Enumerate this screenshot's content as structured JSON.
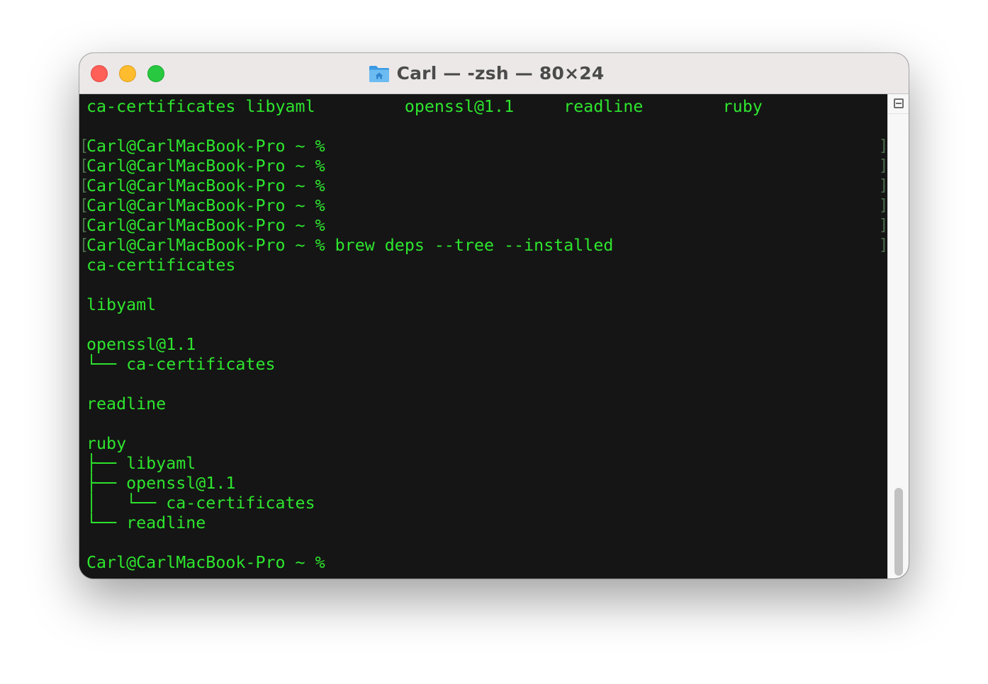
{
  "window": {
    "title": "Carl — -zsh — 80×24",
    "folder_icon": "home-folder-icon"
  },
  "colors": {
    "terminal_bg": "#151515",
    "terminal_text": "#2ee52e",
    "titlebar_bg": "#ece8e8",
    "close": "#fe5f57",
    "minimize": "#febc2e",
    "maximize": "#28c840"
  },
  "terminal": {
    "lines": [
      "ca-certificates libyaml         openssl@1.1     readline        ruby",
      "",
      "Carl@CarlMacBook-Pro ~ %",
      "Carl@CarlMacBook-Pro ~ %",
      "Carl@CarlMacBook-Pro ~ %",
      "Carl@CarlMacBook-Pro ~ %",
      "Carl@CarlMacBook-Pro ~ %",
      "Carl@CarlMacBook-Pro ~ % brew deps --tree --installed",
      "ca-certificates",
      "",
      "libyaml",
      "",
      "openssl@1.1",
      "└── ca-certificates",
      "",
      "readline",
      "",
      "ruby",
      "├── libyaml",
      "├── openssl@1.1",
      "│   └── ca-certificates",
      "└── readline",
      "",
      "Carl@CarlMacBook-Pro ~ %"
    ],
    "bracket_left": "[",
    "bracket_right": "]"
  }
}
